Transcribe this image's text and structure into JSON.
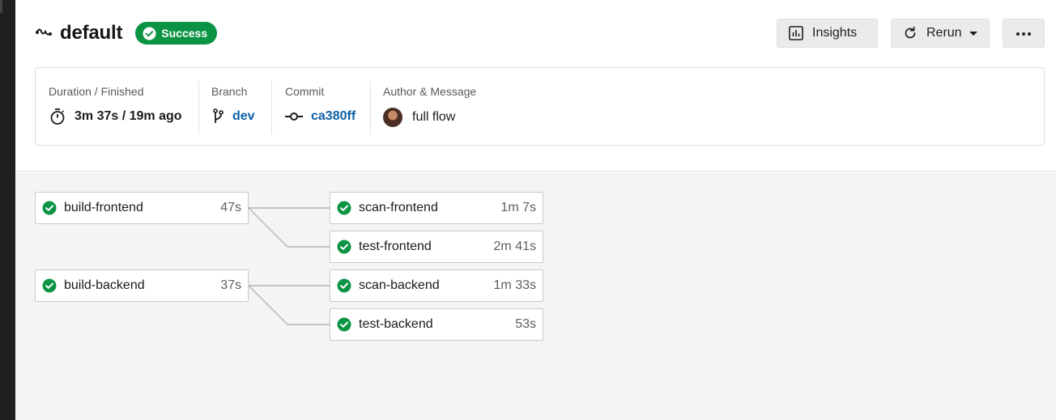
{
  "header": {
    "workflow_icon": "workflow-icon",
    "title": "default",
    "status_label": "Success",
    "status_color": "#0b9444"
  },
  "actions": {
    "insights_label": "Insights",
    "insights_icon": "bar-chart-icon",
    "rerun_label": "Rerun",
    "rerun_icon": "refresh-icon",
    "more_icon": "more-horizontal-icon"
  },
  "info": {
    "duration_label": "Duration / Finished",
    "duration_value": "3m 37s / 19m ago",
    "branch_label": "Branch",
    "branch_value": "dev",
    "commit_label": "Commit",
    "commit_value": "ca380ff",
    "author_label": "Author & Message",
    "message_value": "full flow"
  },
  "jobs": [
    {
      "name": "build-frontend",
      "duration": "47s",
      "status": "success"
    },
    {
      "name": "scan-frontend",
      "duration": "1m 7s",
      "status": "success"
    },
    {
      "name": "test-frontend",
      "duration": "2m 41s",
      "status": "success"
    },
    {
      "name": "build-backend",
      "duration": "37s",
      "status": "success"
    },
    {
      "name": "scan-backend",
      "duration": "1m 33s",
      "status": "success"
    },
    {
      "name": "test-backend",
      "duration": "53s",
      "status": "success"
    }
  ],
  "colors": {
    "success": "#0b9444",
    "link": "#0b5fa5",
    "graph_background": "#f4f4f4"
  }
}
